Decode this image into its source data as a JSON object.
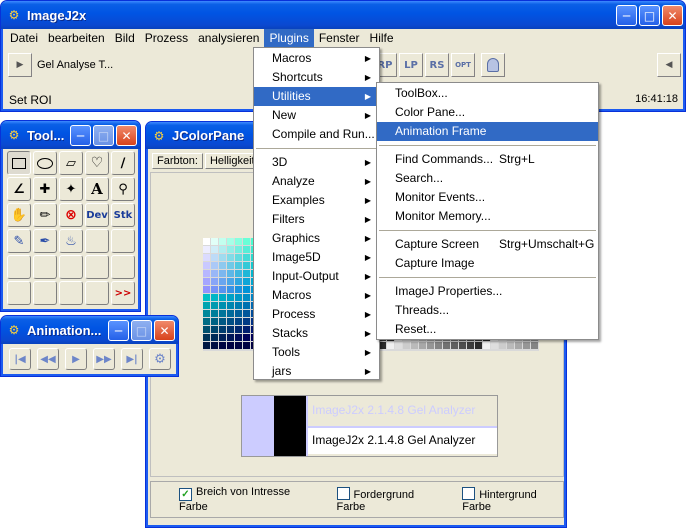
{
  "main_window": {
    "title": "ImageJ2x",
    "menus": [
      "Datei",
      "bearbeiten",
      "Bild",
      "Prozess",
      "analysieren",
      "Plugins",
      "Fenster",
      "Hilfe"
    ],
    "active_menu": "Plugins",
    "toolbar_text": "Gel Analyse T...",
    "toolbar_icons": [
      "RP",
      "LP",
      "RS",
      "OPT"
    ],
    "status_left": "Set ROI",
    "status_right": "16:41:18"
  },
  "tools_window": {
    "title": "Tool...",
    "tool_labels": {
      "dev": "Dev",
      "stk": "Stk",
      "text": "A",
      "more": ">>"
    }
  },
  "animation_window": {
    "title": "Animation..."
  },
  "colorpane_window": {
    "title": "JColorPane",
    "tabs": [
      "Farbton:",
      "Helligkeit:"
    ],
    "preview_text_light": "ImageJ2x 2.1.4.8 Gel Analyzer",
    "preview_text_dark": "ImageJ2x 2.1.4.8 Gel Analyzer",
    "checkboxes": [
      {
        "label": "Breich von Intresse Farbe",
        "checked": true
      },
      {
        "label": "Fordergrund Farbe",
        "checked": false
      },
      {
        "label": "Hintergrund Farbe",
        "checked": false
      }
    ]
  },
  "plugins_menu": {
    "items": [
      {
        "label": "Macros",
        "submenu": true
      },
      {
        "label": "Shortcuts",
        "submenu": true
      },
      {
        "label": "Utilities",
        "submenu": true,
        "highlighted": true
      },
      {
        "label": "New",
        "submenu": true
      },
      {
        "label": "Compile and Run...",
        "submenu": false
      },
      {
        "label": "3D",
        "submenu": true
      },
      {
        "label": "Analyze",
        "submenu": true
      },
      {
        "label": "Examples",
        "submenu": true
      },
      {
        "label": "Filters",
        "submenu": true
      },
      {
        "label": "Graphics",
        "submenu": true
      },
      {
        "label": "Image5D",
        "submenu": true
      },
      {
        "label": "Input-Output",
        "submenu": true
      },
      {
        "label": "Macros",
        "submenu": true
      },
      {
        "label": "Process",
        "submenu": true
      },
      {
        "label": "Stacks",
        "submenu": true
      },
      {
        "label": "Tools",
        "submenu": true
      },
      {
        "label": "jars",
        "submenu": true
      }
    ]
  },
  "utilities_menu": {
    "items": [
      {
        "label": "ToolBox...",
        "shortcut": ""
      },
      {
        "label": "Color Pane...",
        "shortcut": ""
      },
      {
        "label": "Animation Frame",
        "shortcut": "",
        "highlighted": true
      },
      {
        "label": "Find Commands...",
        "shortcut": "Strg+L"
      },
      {
        "label": "Search...",
        "shortcut": ""
      },
      {
        "label": "Monitor Events...",
        "shortcut": ""
      },
      {
        "label": "Monitor Memory...",
        "shortcut": ""
      },
      {
        "label": "Capture Screen",
        "shortcut": "Strg+Umschalt+G"
      },
      {
        "label": "Capture Image",
        "shortcut": ""
      },
      {
        "label": "ImageJ Properties...",
        "shortcut": ""
      },
      {
        "label": "Threads...",
        "shortcut": ""
      },
      {
        "label": "Reset...",
        "shortcut": ""
      }
    ]
  },
  "colors": {
    "titlebar": "#0054e3",
    "menu_highlight": "#316ac5",
    "window_bg": "#ece9d8",
    "close_button": "#d8421c"
  }
}
